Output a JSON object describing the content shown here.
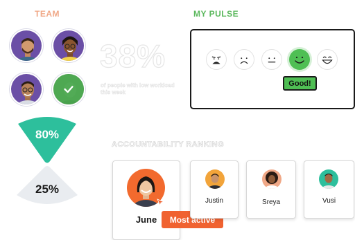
{
  "team": {
    "title": "TEAM",
    "members": [
      {
        "icon": "avatar-man-beard",
        "bg": "#6b4fa6"
      },
      {
        "icon": "avatar-woman-glasses",
        "bg": "#6b4fa6"
      },
      {
        "icon": "avatar-man-glasses",
        "bg": "#6b4fa6"
      },
      {
        "icon": "avatar-checked",
        "bg": "#4caf50",
        "checked": true
      }
    ]
  },
  "stat": {
    "value": "38%",
    "caption": "of people with low workload this week"
  },
  "wedges": [
    {
      "value": "80%",
      "color": "#2dbf9c"
    },
    {
      "value": "25%",
      "color": "#e9ecf0"
    }
  ],
  "pulse": {
    "title": "MY PULSE",
    "faces": [
      {
        "icon": "distressed-face-icon"
      },
      {
        "icon": "sad-face-icon"
      },
      {
        "icon": "neutral-face-icon"
      },
      {
        "icon": "happy-face-icon",
        "selected": true
      },
      {
        "icon": "grinning-face-icon"
      }
    ],
    "selected_label": "Good!"
  },
  "accountability": {
    "title": "ACCOUNTABILITY RANKING",
    "top": {
      "name": "June",
      "badge": "Most active",
      "bg": "#f26a2e"
    },
    "others": [
      {
        "name": "Justin",
        "bg": "#f2a43a"
      },
      {
        "name": "Sreya",
        "bg": "#f0a887"
      },
      {
        "name": "Vusi",
        "bg": "#2dbf9c"
      }
    ]
  },
  "colors": {
    "accent_orange": "#f06230",
    "accent_green": "#4fbf54",
    "team_label": "#f0a887",
    "pulse_label": "#5bb85d"
  }
}
